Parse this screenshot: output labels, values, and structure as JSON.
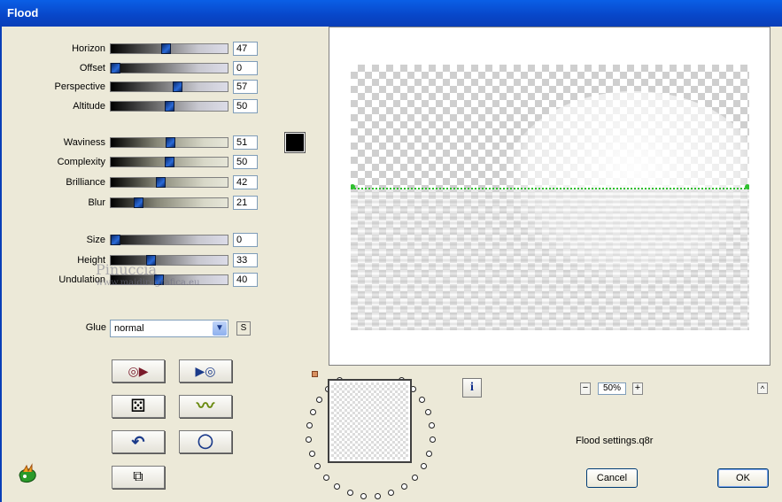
{
  "window": {
    "title": "Flood"
  },
  "sliders": [
    {
      "label": "Horizon",
      "value": "47",
      "fraction": 0.47,
      "style": "a"
    },
    {
      "label": "Offset",
      "value": "0",
      "fraction": 0.0,
      "style": "a"
    },
    {
      "label": "Perspective",
      "value": "57",
      "fraction": 0.57,
      "style": "a"
    },
    {
      "label": "Altitude",
      "value": "50",
      "fraction": 0.5,
      "style": "a"
    },
    {
      "label": "Waviness",
      "value": "51",
      "fraction": 0.51,
      "style": "b"
    },
    {
      "label": "Complexity",
      "value": "50",
      "fraction": 0.5,
      "style": "b"
    },
    {
      "label": "Brilliance",
      "value": "42",
      "fraction": 0.42,
      "style": "b"
    },
    {
      "label": "Blur",
      "value": "21",
      "fraction": 0.21,
      "style": "b"
    },
    {
      "label": "Size",
      "value": "0",
      "fraction": 0.0,
      "style": "a"
    },
    {
      "label": "Height",
      "value": "33",
      "fraction": 0.33,
      "style": "a"
    },
    {
      "label": "Undulation",
      "value": "40",
      "fraction": 0.4,
      "style": "a"
    }
  ],
  "color_swatch": {
    "color": "#000000"
  },
  "glue": {
    "label": "Glue",
    "value": "normal",
    "side_button": "S"
  },
  "tool_buttons": [
    {
      "name": "load-preset-button",
      "icon": "disc-play-icon",
      "glyph": "◎▶"
    },
    {
      "name": "save-preset-button",
      "icon": "play-disc-icon",
      "glyph": "▶◎"
    },
    {
      "name": "random-button",
      "icon": "dice-icon",
      "glyph": "⚄"
    },
    {
      "name": "wave-button",
      "icon": "wave-icon",
      "glyph": "〰"
    },
    {
      "name": "undo-button",
      "icon": "undo-arrow-icon",
      "glyph": "↶"
    },
    {
      "name": "reset-button",
      "icon": "ring-icon",
      "glyph": "◯"
    },
    {
      "name": "copy-button",
      "icon": "copy-pages-icon",
      "glyph": "⧉"
    }
  ],
  "watermark": {
    "line1": "Pinuccia",
    "line2": "www.maidiregrafica.eu"
  },
  "zoom": {
    "value": "50%",
    "minus": "−",
    "plus": "+"
  },
  "info_button": {
    "glyph": "i"
  },
  "up_button": {
    "glyph": "^"
  },
  "preset_file": "Flood settings.q8r",
  "buttons": {
    "cancel": "Cancel",
    "ok": "OK"
  },
  "colors": {
    "titlebar": "#0846c8",
    "thumb": "#2a6ad8",
    "horizon_line": "#30c030"
  }
}
